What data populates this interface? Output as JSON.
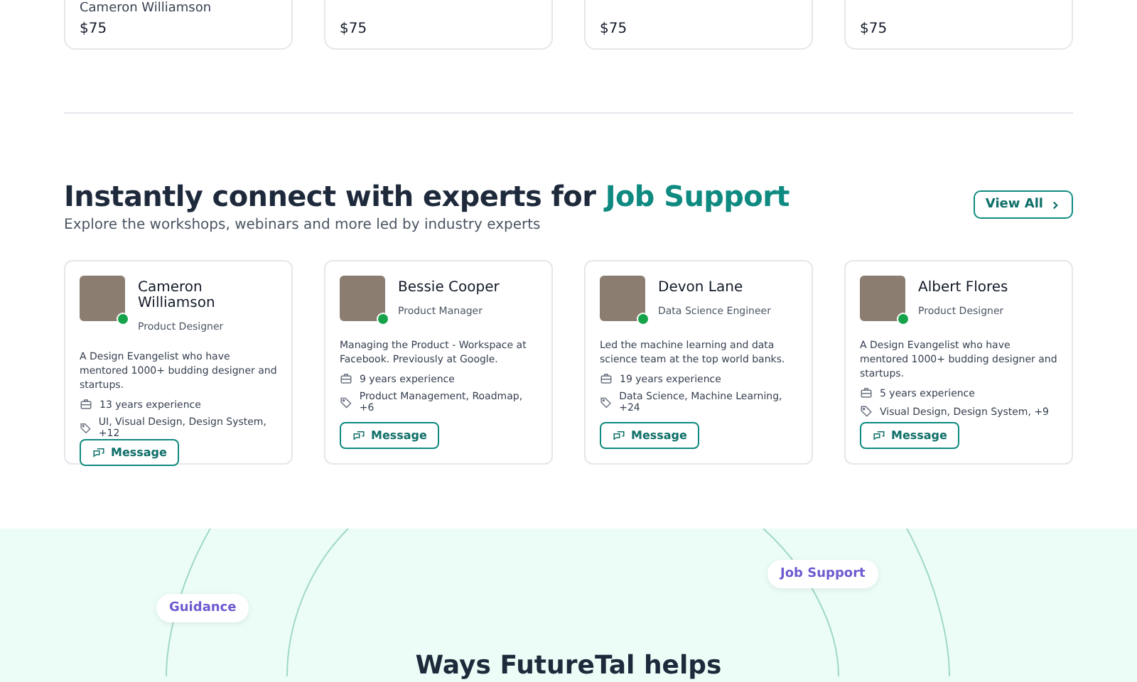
{
  "top_cards": [
    {
      "name": "Cameron Williamson",
      "price": "$75"
    },
    {
      "price": "$75"
    },
    {
      "price": "$75"
    },
    {
      "price": "$75"
    }
  ],
  "section": {
    "title_start": "Instantly connect with experts for",
    "title_highlight": "Job Support",
    "subtitle": "Explore the workshops, webinars and more led by industry experts",
    "view_all": "View All"
  },
  "experts": [
    {
      "name": "Cameron Williamson",
      "role": "Product Designer",
      "online": true,
      "bio": "A Design Evangelist who have mentored 1000+ budding designer and startups.",
      "experience": "13 years experience",
      "skills": "UI, Visual Design, Design System, +12",
      "button": "Message"
    },
    {
      "name": "Bessie Cooper",
      "role": "Product Manager",
      "online": true,
      "bio": "Managing the Product - Workspace at Facebook. Previously at Google.",
      "experience": "9 years experience",
      "skills": "Product Management, Roadmap, +6",
      "button": "Message"
    },
    {
      "name": "Devon Lane",
      "role": "Data Science Engineer",
      "online": true,
      "bio": "Led the machine learning and  data science team at the top world banks.",
      "experience": "19 years experience",
      "skills": "Data Science, Machine Learning, +24",
      "button": "Message"
    },
    {
      "name": "Albert Flores",
      "role": "Product Designer",
      "online": true,
      "bio": "A Design Evangelist who have mentored 1000+ budding designer and startups.",
      "experience": "5 years experience",
      "skills": "Visual Design, Design System, +9",
      "button": "Message"
    }
  ],
  "helps": {
    "pills": [
      "Guidance",
      "Job Support"
    ],
    "title": "Ways FutureTal helps"
  }
}
